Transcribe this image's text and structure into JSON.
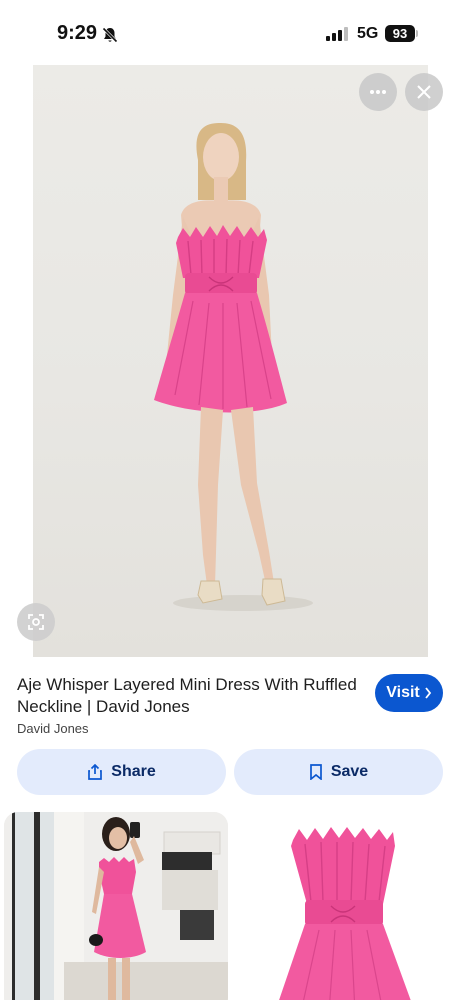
{
  "status_bar": {
    "time": "9:29",
    "network": "5G",
    "battery": "93",
    "bell_icon": "bell-slash-icon",
    "signal_icon": "cellular-signal-icon"
  },
  "hero": {
    "more_icon": "more-horizontal-icon",
    "close_icon": "close-icon",
    "lens_icon": "lens-search-icon"
  },
  "product": {
    "title": "Aje Whisper Layered Mini Dress With Ruffled Neckline | David Jones",
    "source": "David Jones",
    "visit_label": "Visit"
  },
  "actions": {
    "share_label": "Share",
    "save_label": "Save"
  },
  "colors": {
    "accent": "#0b57d0",
    "chip_bg": "#e3ebfc",
    "dress_pink": "#f0529a"
  }
}
